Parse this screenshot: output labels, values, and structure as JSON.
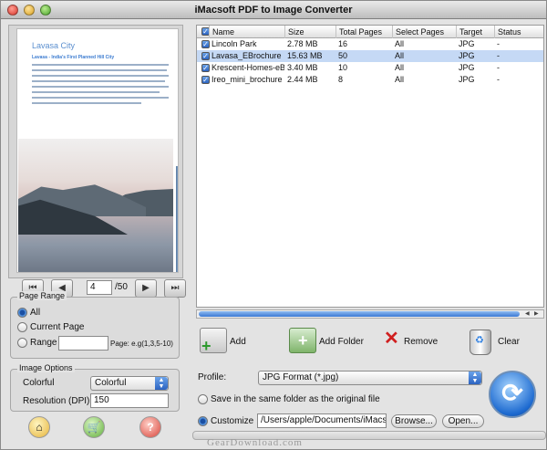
{
  "window": {
    "title": "iMacsoft PDF to Image Converter"
  },
  "preview": {
    "page_title": "Lavasa City",
    "page_subtitle": "Lavasa - India's First Planned Hill City",
    "current_page": "4",
    "total_pages": "/50"
  },
  "page_range": {
    "legend": "Page Range",
    "options": [
      "All",
      "Current Page",
      "Range"
    ],
    "selected": "All",
    "range_value": "",
    "range_hint": "Page: e.g(1,3,5-10)"
  },
  "image_options": {
    "legend": "Image Options",
    "color_label": "Colorful",
    "color_value": "Colorful",
    "resolution_label": "Resolution (DPI)",
    "resolution_value": "150"
  },
  "table": {
    "columns": [
      "Name",
      "Size",
      "Total Pages",
      "Select Pages",
      "Target",
      "Status"
    ],
    "rows": [
      {
        "name": "Lincoln Park",
        "size": "2.78 MB",
        "pages": "16",
        "select": "All",
        "target": "JPG",
        "status": "-"
      },
      {
        "name": "Lavasa_EBrochure",
        "size": "15.63 MB",
        "pages": "50",
        "select": "All",
        "target": "JPG",
        "status": "-"
      },
      {
        "name": "Krescent-Homes-eBrochure",
        "size": "3.40 MB",
        "pages": "10",
        "select": "All",
        "target": "JPG",
        "status": "-"
      },
      {
        "name": "Ireo_mini_brochure",
        "size": "2.44 MB",
        "pages": "8",
        "select": "All",
        "target": "JPG",
        "status": "-"
      }
    ],
    "selected_row": 1
  },
  "actions": {
    "add": "Add",
    "add_folder": "Add Folder",
    "remove": "Remove",
    "clear": "Clear"
  },
  "output": {
    "profile_label": "Profile:",
    "profile_value": "JPG Format  (*.jpg)",
    "same_folder_label": "Save in the same folder as the original file",
    "customize_label": "Customize",
    "customize_path": "/Users/apple/Documents/iMacsoft",
    "browse": "Browse...",
    "open": "Open..."
  },
  "watermark": "GearDownload.com",
  "colors": {
    "accent": "#3b78d4",
    "selection": "#c5d9f5"
  }
}
